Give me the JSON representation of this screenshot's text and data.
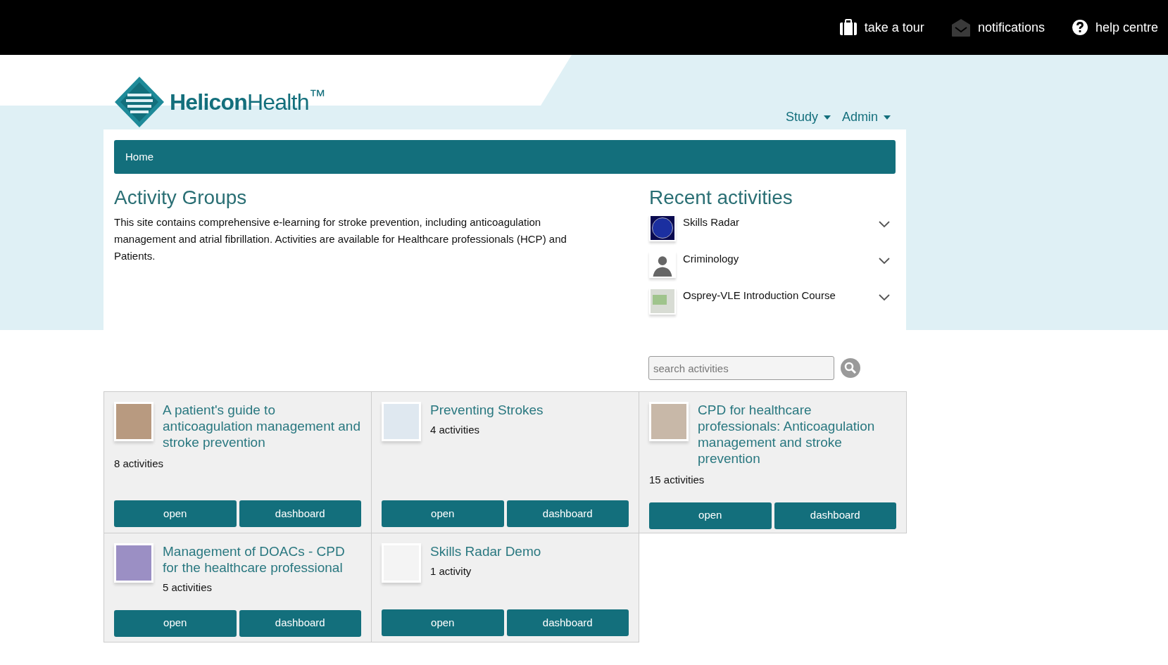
{
  "top_bar": {
    "links": [
      {
        "kind": "tour",
        "label": "take a tour"
      },
      {
        "kind": "notifications",
        "label": "notifications"
      },
      {
        "kind": "help",
        "label": "help centre"
      }
    ]
  },
  "logo": {
    "text": "**Helicon**Health$^{™}$"
  },
  "nav": {
    "menus": [
      "Study",
      "Admin"
    ]
  },
  "breadcrumb": {
    "items": [
      "Home"
    ]
  },
  "activity_groups": {
    "heading": "Activity Groups",
    "description": "This site contains comprehensive e-learning for stroke prevention, including anticoagulation management and atrial fibrillation. Activities are available for Healthcare professionals (HCP) and Patients."
  },
  "recent_activities": {
    "heading": "Recent activities",
    "items": [
      {
        "kind": "radar",
        "name": "Skills Radar"
      },
      {
        "kind": "person",
        "name": "Criminology"
      },
      {
        "kind": "course",
        "name": "Osprey-VLE Introduction Course"
      }
    ]
  },
  "search": {
    "placeholder": "search activities"
  },
  "groups": [
    {
      "kind": "people",
      "title": "A patient's guide to anticoagulation management and stroke prevention",
      "count": "8 activities",
      "buttons": [
        "open",
        "dashboard"
      ]
    },
    {
      "kind": "device",
      "title": "Preventing Strokes",
      "count": "4 activities",
      "buttons": [
        "open",
        "dashboard"
      ]
    },
    {
      "kind": "clinician",
      "title": "CPD for healthcare professionals: Anticoagulation management and stroke prevention",
      "count": "15 activities",
      "buttons": [
        "open",
        "dashboard"
      ]
    },
    {
      "kind": "pills",
      "title": "Management of DOACs - CPD for the healthcare professional",
      "count": "5 activities",
      "buttons": [
        "open",
        "dashboard"
      ]
    },
    {
      "kind": "document",
      "title": "Skills Radar Demo",
      "count": "1 activity",
      "buttons": [
        "open",
        "dashboard"
      ]
    }
  ]
}
